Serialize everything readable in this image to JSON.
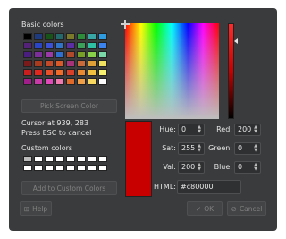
{
  "basic_colors": {
    "label": "Basic colors",
    "rows": [
      [
        "#000000",
        "#1e3b80",
        "#17541a",
        "#246a6d",
        "#7a7a2a",
        "#2d8c3a",
        "#39a6a6",
        "#2e9be0"
      ],
      [
        "#55227a",
        "#2a46c6",
        "#3b52d8",
        "#2f74c8",
        "#5b2ea5",
        "#3aa05a",
        "#2fc0a4",
        "#3b84f0"
      ],
      [
        "#4a1e7e",
        "#7c2e9a",
        "#9a3aa8",
        "#2e6fd0",
        "#b04a2a",
        "#78a028",
        "#88d04a",
        "#7ad8a8"
      ],
      [
        "#7a1a1a",
        "#a83a1e",
        "#c04a2a",
        "#d85a2a",
        "#a8327a",
        "#c86a3a",
        "#e0a038",
        "#f0e060"
      ],
      [
        "#c81e1e",
        "#e0281e",
        "#e8502a",
        "#f06a2a",
        "#d8402a",
        "#e88a32",
        "#f0c040",
        "#f8f070"
      ],
      [
        "#a01e8a",
        "#c83aa8",
        "#e04ab8",
        "#f07ab0",
        "#e06a2a",
        "#f0a048",
        "#f8d860",
        "#fbfbfb"
      ]
    ],
    "pick_screen_label": "Pick Screen Color"
  },
  "cursor_status": {
    "line1": "Cursor at 939, 283",
    "line2": "Press ESC to cancel"
  },
  "custom_colors": {
    "label": "Custom colors",
    "cells": [
      "#bdbdbd",
      "#ffffff",
      "#ffffff",
      "#ffffff",
      "#ffffff",
      "#ffffff",
      "#ffffff",
      "#ffffff",
      "#ffffff",
      "#ffffff",
      "#ffffff",
      "#ffffff",
      "#ffffff",
      "#ffffff",
      "#ffffff",
      "#ffffff"
    ],
    "add_label": "Add to Custom Colors"
  },
  "current_color": "#c80000",
  "fields": {
    "hue_label": "Hue:",
    "hue": "0",
    "sat_label": "Sat:",
    "sat": "255",
    "val_label": "Val:",
    "val": "200",
    "red_label": "Red:",
    "red": "200",
    "green_label": "Green:",
    "green": "0",
    "blue_label": "Blue:",
    "blue": "0",
    "html_label": "HTML:",
    "html": "#c80000"
  },
  "buttons": {
    "help": "Help",
    "ok": "OK",
    "cancel": "Cancel"
  }
}
